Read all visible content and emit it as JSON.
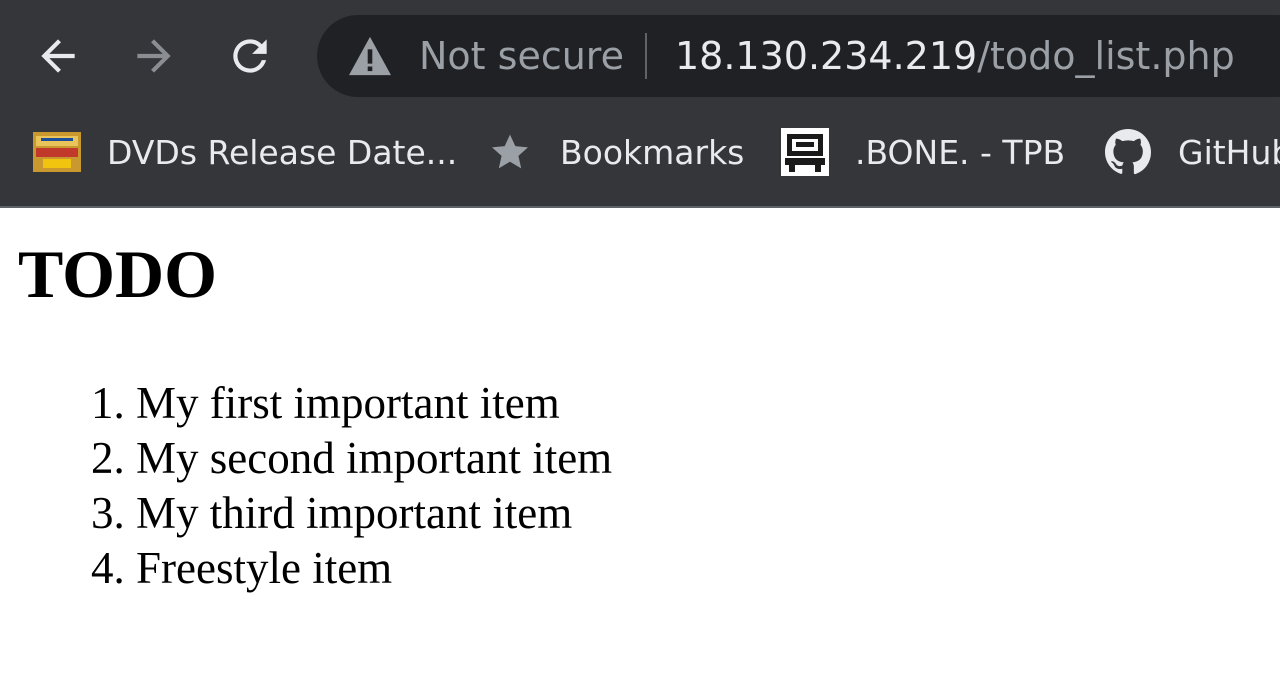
{
  "browser": {
    "security_label": "Not secure",
    "url_host": "18.130.234.219",
    "url_path": "/todo_list.php",
    "icons": {
      "back": "arrow-left-icon",
      "forward": "arrow-right-icon",
      "reload": "reload-icon",
      "security": "warning-triangle-icon"
    },
    "colors": {
      "chrome_bg": "#35363a",
      "omnibox_bg": "#202124",
      "text": "#e8eaed",
      "muted_text": "#9aa0a6"
    }
  },
  "bookmarks": [
    {
      "label": "DVDs Release Date...",
      "icon": "dvd-release-favicon"
    },
    {
      "label": "Bookmarks",
      "icon": "star-icon"
    },
    {
      "label": ".BONE. - TPB",
      "icon": "bone-favicon"
    },
    {
      "label": "GitHub",
      "icon": "github-icon"
    }
  ],
  "page": {
    "title": "TODO",
    "items": [
      "My first important item",
      "My second important item",
      "My third important item",
      "Freestyle item"
    ]
  }
}
